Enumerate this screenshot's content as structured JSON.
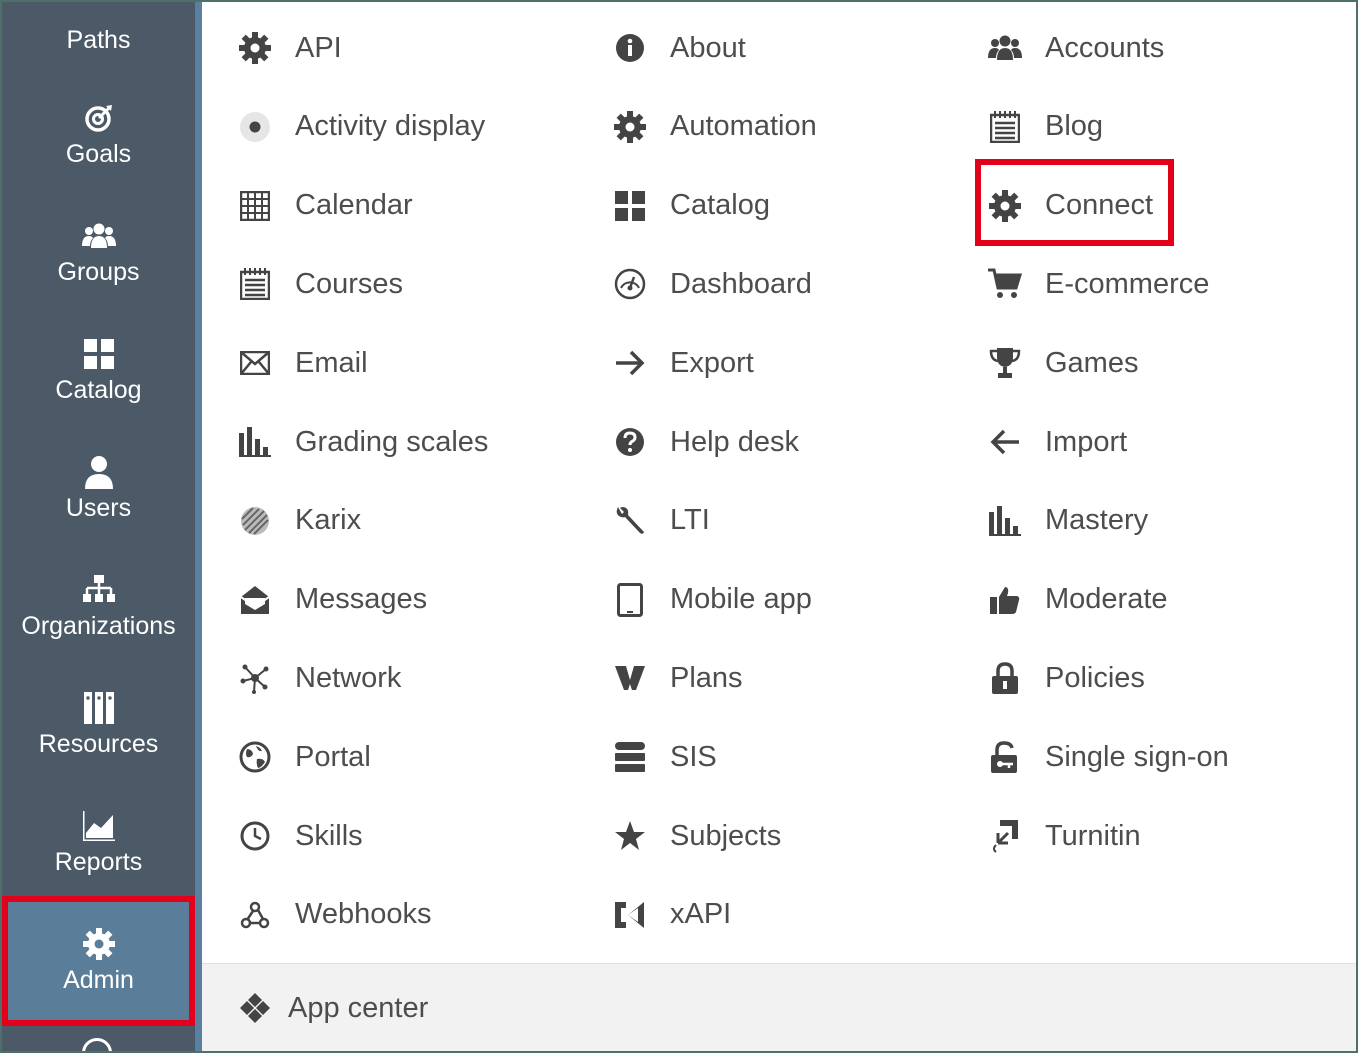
{
  "sidebar": {
    "items": [
      {
        "label": "Paths",
        "icon": "paths-icon"
      },
      {
        "label": "Goals",
        "icon": "target-icon"
      },
      {
        "label": "Groups",
        "icon": "group-icon"
      },
      {
        "label": "Catalog",
        "icon": "grid-icon"
      },
      {
        "label": "Users",
        "icon": "user-icon"
      },
      {
        "label": "Organizations",
        "icon": "org-chart-icon"
      },
      {
        "label": "Resources",
        "icon": "binders-icon"
      },
      {
        "label": "Reports",
        "icon": "chart-icon"
      },
      {
        "label": "Admin",
        "icon": "gear-icon",
        "active": true
      }
    ]
  },
  "menu": {
    "col1": [
      {
        "label": "API",
        "icon": "gear-icon"
      },
      {
        "label": "Activity display",
        "icon": "radio-dot-icon"
      },
      {
        "label": "Calendar",
        "icon": "calendar-grid-icon"
      },
      {
        "label": "Courses",
        "icon": "notepad-icon"
      },
      {
        "label": "Email",
        "icon": "envelope-icon"
      },
      {
        "label": "Grading scales",
        "icon": "bar-chart-icon"
      },
      {
        "label": "Karix",
        "icon": "karix-icon"
      },
      {
        "label": "Messages",
        "icon": "open-envelope-icon"
      },
      {
        "label": "Network",
        "icon": "network-icon"
      },
      {
        "label": "Portal",
        "icon": "globe-icon"
      },
      {
        "label": "Skills",
        "icon": "clock-icon"
      },
      {
        "label": "Webhooks",
        "icon": "webhooks-icon"
      }
    ],
    "col2": [
      {
        "label": "About",
        "icon": "info-icon"
      },
      {
        "label": "Automation",
        "icon": "gear-icon"
      },
      {
        "label": "Catalog",
        "icon": "grid-icon"
      },
      {
        "label": "Dashboard",
        "icon": "gauge-icon"
      },
      {
        "label": "Export",
        "icon": "arrow-right-icon"
      },
      {
        "label": "Help desk",
        "icon": "question-icon"
      },
      {
        "label": "LTI",
        "icon": "wrench-icon"
      },
      {
        "label": "Mobile app",
        "icon": "tablet-icon"
      },
      {
        "label": "Plans",
        "icon": "plans-icon"
      },
      {
        "label": "SIS",
        "icon": "database-icon"
      },
      {
        "label": "Subjects",
        "icon": "star-icon"
      },
      {
        "label": "xAPI",
        "icon": "xapi-icon"
      }
    ],
    "col3": [
      {
        "label": "Accounts",
        "icon": "group-icon"
      },
      {
        "label": "Blog",
        "icon": "notepad-icon"
      },
      {
        "label": "Connect",
        "icon": "gear-icon",
        "highlighted": true
      },
      {
        "label": "E-commerce",
        "icon": "cart-icon"
      },
      {
        "label": "Games",
        "icon": "trophy-icon"
      },
      {
        "label": "Import",
        "icon": "arrow-left-icon"
      },
      {
        "label": "Mastery",
        "icon": "bar-chart-icon"
      },
      {
        "label": "Moderate",
        "icon": "thumbs-up-icon"
      },
      {
        "label": "Policies",
        "icon": "lock-icon"
      },
      {
        "label": "Single sign-on",
        "icon": "unlock-icon"
      },
      {
        "label": "Turnitin",
        "icon": "turnitin-icon"
      }
    ]
  },
  "footer": {
    "label": "App center",
    "icon": "app-center-icon"
  },
  "colors": {
    "sidebar": "#4b5a66",
    "sidebar_active": "#5a7d99",
    "highlight": "#e2001a",
    "text": "#4d4d4d",
    "icon": "#444444"
  }
}
